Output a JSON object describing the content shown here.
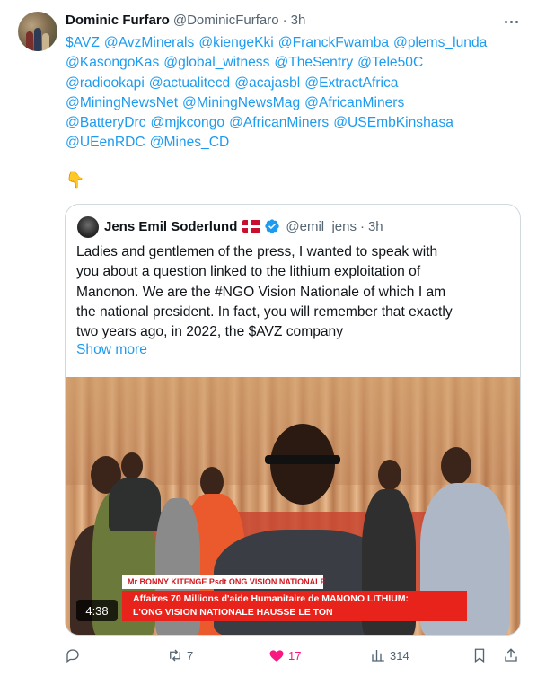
{
  "tweet": {
    "author_name": "Dominic Furfaro",
    "author_handle": "@DominicFurfaro",
    "separator": "·",
    "time": "3h",
    "mention_lines": [
      [
        "$AVZ",
        "@AvzMinerals",
        "@kiengeKki",
        "@FranckFwamba",
        "@plems_lunda"
      ],
      [
        "@KasongoKas",
        "@global_witness",
        "@TheSentry",
        "@Tele50C"
      ],
      [
        "@radiookapi",
        "@actualitecd",
        "@acajasbl",
        "@ExtractAfrica"
      ],
      [
        "@MiningNewsNet",
        "@MiningNewsMag",
        "@AfricanMiners"
      ],
      [
        "@BatteryDrc",
        "@mjkcongo",
        "@AfricanMiners",
        "@USEmbKinshasa"
      ],
      [
        "@UEenRDC",
        "@Mines_CD"
      ]
    ],
    "emoji": "👇"
  },
  "quote": {
    "author_name": "Jens Emil Soderlund",
    "author_handle": "@emil_jens",
    "separator": "·",
    "time": "3h",
    "text_lines": [
      "Ladies and gentlemen of the press, I wanted to speak with",
      "you about a question linked to the lithium exploitation of",
      "Manonon. We are the #NGO Vision Nationale of which I am",
      "the national president. In fact, you will remember that exactly",
      "two years ago, in 2022, the $AVZ company"
    ],
    "show_more": "Show more",
    "video": {
      "lower_third_name": "Mr BONNY KITENGE  Psdt ONG VISION NATIONALE",
      "headline_1": "Affaires 70 Millions d'aide Humanitaire de MANONO LITHIUM:",
      "headline_2": "L'ONG VISION NATIONALE HAUSSE LE TON",
      "duration": "4:38"
    }
  },
  "actions": {
    "reply_count": "",
    "retweet_count": "7",
    "like_count": "17",
    "views_count": "314"
  },
  "colors": {
    "link": "#1d9bf0",
    "like": "#f91880",
    "muted": "#536471",
    "verified": "#1d9bf0"
  }
}
